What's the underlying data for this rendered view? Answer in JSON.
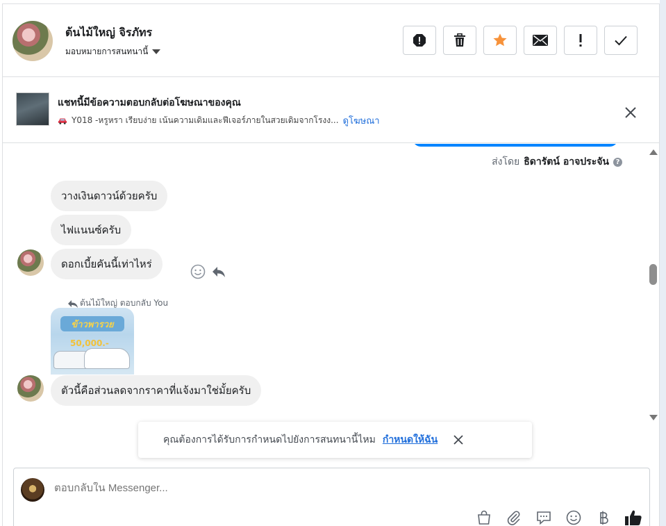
{
  "header": {
    "contact_name": "ต้นไม้ใหญ่ จิรภัทร",
    "assign_label": "มอบหมายการสนทนานี้",
    "toolbar": [
      {
        "name": "spam-icon"
      },
      {
        "name": "trash-icon"
      },
      {
        "name": "star-icon"
      },
      {
        "name": "envelope-icon"
      },
      {
        "name": "exclamation-icon"
      },
      {
        "name": "checkmark-icon"
      }
    ]
  },
  "ad_banner": {
    "title": "แชทนี้มีข้อความตอบกลับต่อโฆษณาของคุณ",
    "subtitle": "Y018 -หรูหรา เรียบง่าย เน้นความเดิมและฟีเจอร์ภายในสวยเดิมจากโรงง...",
    "link": "ดูโฆษณา"
  },
  "conversation": {
    "sent_by_prefix": "ส่งโดย",
    "sent_by_name": "ธิดารัตน์ อาจประจัน",
    "messages": [
      "วางเงินดาวน์ด้วยครับ",
      "ไฟแนนซ์ครับ",
      "ดอกเบี้ยคันนี้เท่าไหร่",
      "ตัวนี้คือส่วนลดจากราคาที่แจ้งมาใช่มั้ยครับ"
    ],
    "reply_note": "ต้นไม้ใหญ่ ตอบกลับ You",
    "ad_image": {
      "logo_text": "ข้าวพารวย",
      "price_text": "50,000.-"
    }
  },
  "toast": {
    "text": "คุณต้องการได้รับการกำหนดไปยังการสนทนานี้ไหม",
    "link": "กำหนดให้ฉัน"
  },
  "composer": {
    "placeholder": "ตอบกลับใน Messenger..."
  },
  "colors": {
    "accent": "#216fdb",
    "sent_bubble": "#0084ff",
    "received_bubble": "#f0f0f0",
    "star": "#f7923a"
  }
}
